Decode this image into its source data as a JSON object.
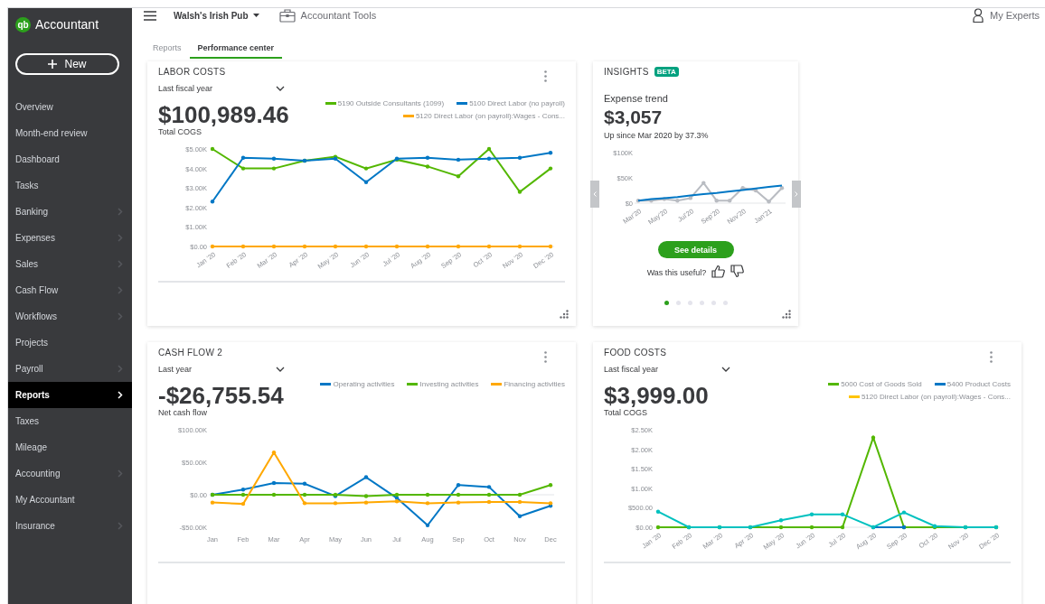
{
  "sidebar": {
    "logo_badge": "qb",
    "logo_text": "Accountant",
    "new_button": "New",
    "items": [
      {
        "label": "Overview",
        "selected": false,
        "submenu": false
      },
      {
        "label": "Month-end review",
        "selected": false,
        "submenu": false
      },
      {
        "label": "Dashboard",
        "selected": false,
        "submenu": false
      },
      {
        "label": "Tasks",
        "selected": false,
        "submenu": false
      },
      {
        "label": "Banking",
        "selected": false,
        "submenu": true
      },
      {
        "label": "Expenses",
        "selected": false,
        "submenu": true
      },
      {
        "label": "Sales",
        "selected": false,
        "submenu": true
      },
      {
        "label": "Cash Flow",
        "selected": false,
        "submenu": true
      },
      {
        "label": "Workflows",
        "selected": false,
        "submenu": true
      },
      {
        "label": "Projects",
        "selected": false,
        "submenu": false
      },
      {
        "label": "Payroll",
        "selected": false,
        "submenu": true
      },
      {
        "label": "Reports",
        "selected": true,
        "submenu": true
      },
      {
        "label": "Taxes",
        "selected": false,
        "submenu": false
      },
      {
        "label": "Mileage",
        "selected": false,
        "submenu": false
      },
      {
        "label": "Accounting",
        "selected": false,
        "submenu": true
      },
      {
        "label": "My Accountant",
        "selected": false,
        "submenu": false
      },
      {
        "label": "Insurance",
        "selected": false,
        "submenu": true
      }
    ]
  },
  "topbar": {
    "company": "Walsh's Irish Pub",
    "tools": "Accountant Tools",
    "experts": "My Experts"
  },
  "tabs": [
    {
      "label": "Reports",
      "selected": false
    },
    {
      "label": "Performance center",
      "selected": true
    }
  ],
  "cards": [
    {
      "kind": "metric",
      "title": "LABOR COSTS",
      "period": "Last fiscal year",
      "amount": "$100,989.46",
      "amount_label": "Total COGS",
      "resizable": true,
      "chart_data": {
        "type": "line",
        "categories": [
          "Jan '20",
          "Feb '20",
          "Mar '20",
          "Apr '20",
          "May '20",
          "Jun '20",
          "Jul '20",
          "Aug '20",
          "Sep '20",
          "Oct '20",
          "Nov '20",
          "Dec '20"
        ],
        "ylim": [
          0,
          5
        ],
        "yticks": [
          {
            "value": 0,
            "label": "$0.00"
          },
          {
            "value": 1,
            "label": "$1.00K"
          },
          {
            "value": 2,
            "label": "$2.00K"
          },
          {
            "value": 3,
            "label": "$3.00K"
          },
          {
            "value": 4,
            "label": "$4.00K"
          },
          {
            "value": 5,
            "label": "$5.00K"
          }
        ],
        "series": [
          {
            "name": "5190 Outside Consultants (1099)",
            "color": "#53b700",
            "values": [
              5,
              4,
              4,
              4.4,
              4.6,
              4,
              4.45,
              4.1,
              3.6,
              5,
              2.8,
              4
            ]
          },
          {
            "name": "5100 Direct Labor (no payroll)",
            "color": "#0077c5",
            "values": [
              2.3,
              4.55,
              4.5,
              4.4,
              4.5,
              3.3,
              4.5,
              4.55,
              4.45,
              4.5,
              4.55,
              4.8
            ]
          },
          {
            "name": "5120 Direct Labor (on payroll):Wages - Cons...",
            "color": "#ffa800",
            "values": [
              0,
              0,
              0,
              0,
              0,
              0,
              0,
              0,
              0,
              0,
              0,
              0
            ]
          }
        ]
      }
    },
    {
      "kind": "insight",
      "title": "INSIGHTS",
      "badge": "BETA",
      "subtitle": "Expense trend",
      "amount": "$3,057",
      "description": "Up since Mar 2020 by 37.3%",
      "button": "See details",
      "feedback_prompt": "Was this useful?",
      "resizable": true,
      "pager": [
        {
          "selected": true
        },
        {
          "selected": false
        },
        {
          "selected": false
        },
        {
          "selected": false
        },
        {
          "selected": false
        },
        {
          "selected": false
        }
      ],
      "chart_data": {
        "type": "line",
        "categories": [
          "Mar'20",
          null,
          "May'20",
          null,
          "Jul'20",
          null,
          "Sep'20",
          null,
          "Nov'20",
          null,
          "Jan'21",
          null
        ],
        "ylim": [
          0,
          100
        ],
        "yticks": [
          {
            "value": 0,
            "label": "$0"
          },
          {
            "value": 50,
            "label": "$50K"
          },
          {
            "value": 100,
            "label": "$100K"
          }
        ],
        "series": [
          {
            "color": "#b9bcc2",
            "values": [
              5,
              5,
              8,
              5,
              10,
              40,
              5,
              5,
              30,
              25,
              3,
              30
            ]
          },
          {
            "color": "#0077c5",
            "values": [
              5,
              8,
              10,
              12,
              15,
              18,
              20,
              23,
              26,
              29,
              32,
              35
            ]
          }
        ]
      }
    },
    {
      "kind": "metric",
      "title": "CASH FLOW 2",
      "period": "Last year",
      "amount": "-$26,755.54",
      "amount_label": "Net cash flow",
      "chart_data": {
        "type": "line",
        "categories": [
          "Jan",
          "Feb",
          "Mar",
          "Apr",
          "May",
          "Jun",
          "Jul",
          "Aug",
          "Sep",
          "Oct",
          "Nov",
          "Dec"
        ],
        "ylim": [
          -50,
          100
        ],
        "yticks": [
          {
            "value": -50,
            "label": "-$50.00K"
          },
          {
            "value": 0,
            "label": "$0.00"
          },
          {
            "value": 50,
            "label": "$50.00K"
          },
          {
            "value": 100,
            "label": "$100.00K"
          }
        ],
        "series": [
          {
            "name": "Operating activities",
            "color": "#0077c5",
            "values": [
              0,
              8,
              18,
              17,
              -2,
              27,
              -5,
              -47,
              15,
              12,
              -33,
              -17
            ]
          },
          {
            "name": "Investing activities",
            "color": "#53b700",
            "values": [
              0,
              0,
              0,
              0,
              0,
              -2,
              0,
              0,
              0,
              0,
              0,
              15
            ]
          },
          {
            "name": "Financing activities",
            "color": "#ffa800",
            "values": [
              -12,
              -14,
              65,
              -13,
              -13,
              -12,
              -10,
              -13,
              -12,
              -11,
              -11,
              -13
            ]
          }
        ]
      }
    },
    {
      "kind": "metric",
      "title": "FOOD COSTS",
      "period": "Last fiscal year",
      "amount": "$3,999.00",
      "amount_label": "Total COGS",
      "chart_data": {
        "type": "line",
        "categories": [
          "Jan '20",
          "Feb '20",
          "Mar '20",
          "Apr '20",
          "May '20",
          "Jun '20",
          "Jul '20",
          "Aug '20",
          "Sep '20",
          "Oct '20",
          "Nov '20",
          "Dec '20"
        ],
        "ylim": [
          0,
          2500
        ],
        "yticks": [
          {
            "value": 0,
            "label": "$0.00"
          },
          {
            "value": 500,
            "label": "$500.00"
          },
          {
            "value": 1000,
            "label": "$1.00K"
          },
          {
            "value": 1500,
            "label": "$1.50K"
          },
          {
            "value": 2000,
            "label": "$2.00K"
          },
          {
            "value": 2500,
            "label": "$2.50K"
          }
        ],
        "series": [
          {
            "name": "5000 Cost of Goods Sold",
            "color": "#53b700",
            "values": [
              0,
              0,
              0,
              0,
              0,
              0,
              0,
              2300,
              0,
              0,
              0,
              0
            ]
          },
          {
            "name": "5400 Product Costs",
            "color": "#0077c5",
            "values": [
              null,
              null,
              null,
              null,
              null,
              null,
              null,
              0,
              0,
              null,
              null,
              null
            ]
          },
          {
            "name": "5120 Direct Labor (on payroll):Wages - Cons...",
            "color": "#ffc400",
            "values": [
              null,
              null,
              null,
              null,
              null,
              null,
              null,
              null,
              null,
              null,
              null,
              null
            ]
          },
          {
            "color": "#00c1bf",
            "values": [
              400,
              0,
              0,
              0,
              180,
              330,
              330,
              0,
              380,
              30,
              0,
              0
            ]
          }
        ]
      }
    }
  ]
}
